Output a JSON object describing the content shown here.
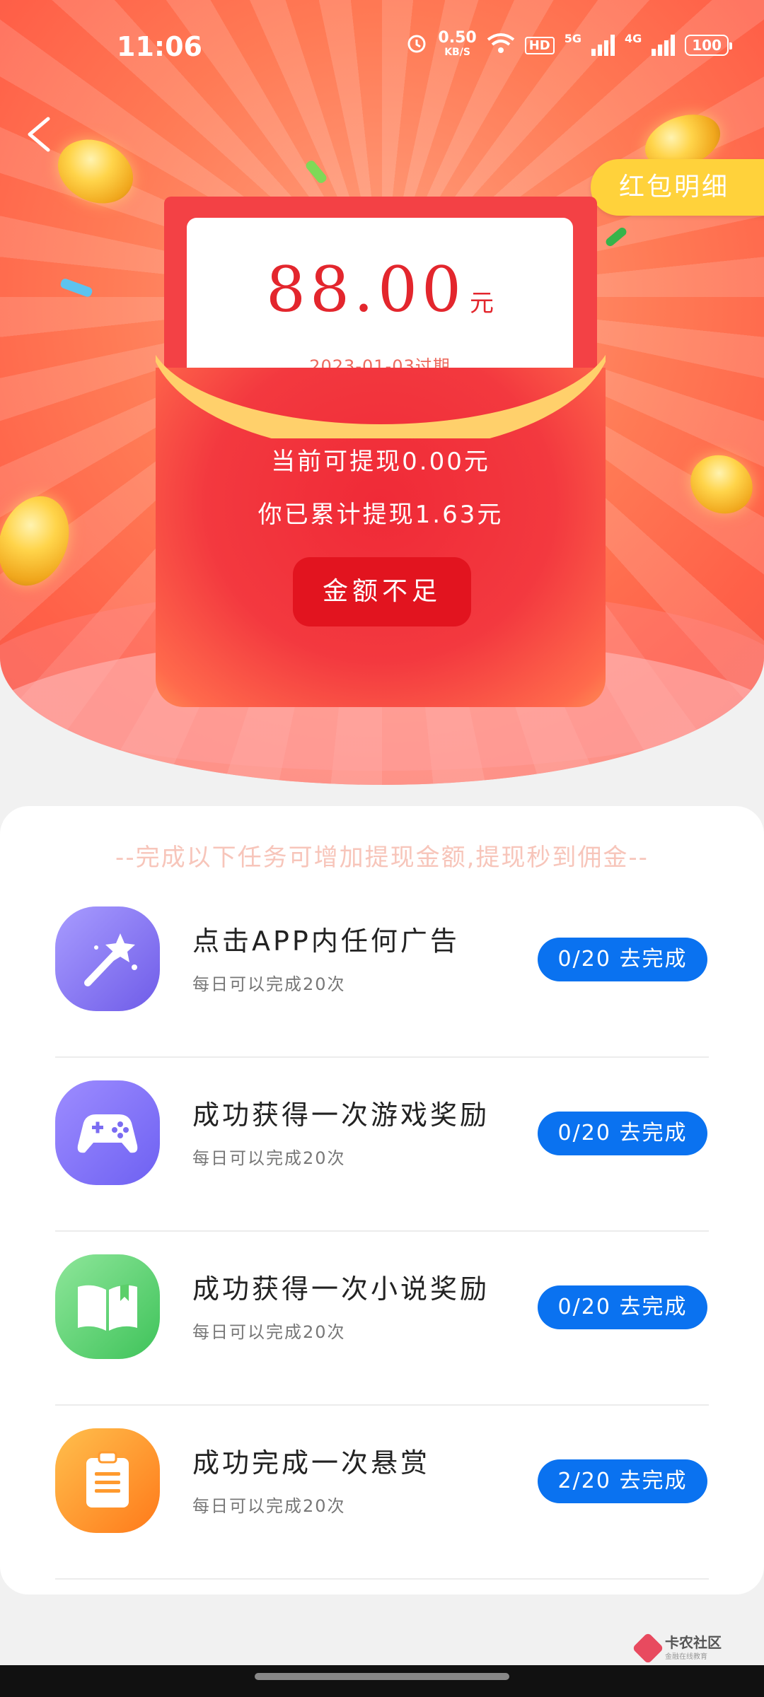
{
  "status": {
    "time": "11:06",
    "net_speed": "0.50",
    "net_unit": "KB/S",
    "hd": "HD",
    "net1": "5G",
    "net2": "4G",
    "battery": "100"
  },
  "header": {
    "detail_label": "红包明细"
  },
  "envelope": {
    "amount": "88.00",
    "unit": "元",
    "expire": "2023-01-03过期",
    "current": "当前可提现0.00元",
    "total": "你已累计提现1.63元",
    "button": "金额不足"
  },
  "tasks_tip": "--完成以下任务可增加提现金额,提现秒到佣金--",
  "tasks": [
    {
      "title": "点击APP内任何广告",
      "sub": "每日可以完成20次",
      "action": "0/20 去完成",
      "icon": "magic-wand-icon"
    },
    {
      "title": "成功获得一次游戏奖励",
      "sub": "每日可以完成20次",
      "action": "0/20 去完成",
      "icon": "gamepad-icon"
    },
    {
      "title": "成功获得一次小说奖励",
      "sub": "每日可以完成20次",
      "action": "0/20 去完成",
      "icon": "book-icon"
    },
    {
      "title": "成功完成一次悬赏",
      "sub": "每日可以完成20次",
      "action": "2/20 去完成",
      "icon": "clipboard-icon"
    }
  ],
  "watermark": {
    "name": "卡农社区",
    "tagline": "金融在线教育"
  }
}
